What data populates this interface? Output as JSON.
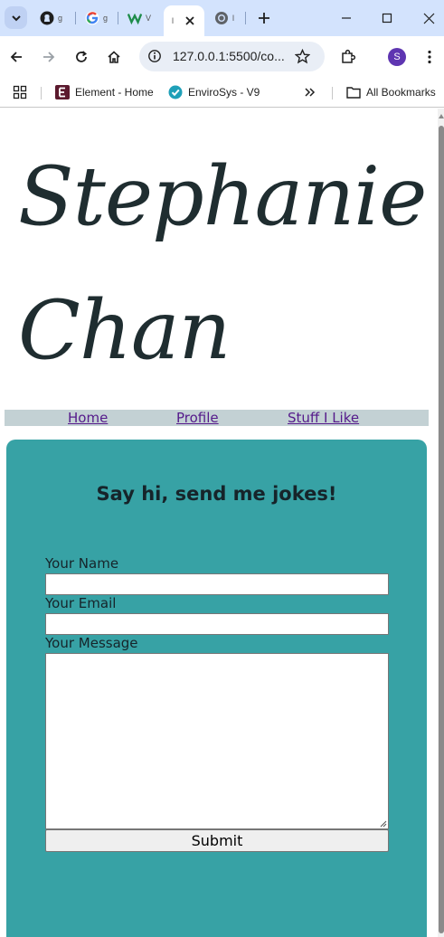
{
  "browser": {
    "tabs": [
      {
        "title": "g",
        "icon": "github-icon"
      },
      {
        "title": "g",
        "icon": "google-icon"
      },
      {
        "title": "V",
        "icon": "w-logo-icon"
      },
      {
        "title": "l",
        "icon": "blank-page-icon",
        "active": true
      },
      {
        "title": "l",
        "icon": "chrome-icon"
      }
    ],
    "url": "127.0.0.1:5500/co...",
    "profile_initial": "S",
    "bookmarks": [
      {
        "label": "Element - Home",
        "icon": "element-e-icon"
      },
      {
        "label": "EnviroSys - V9",
        "icon": "check-badge-icon"
      }
    ],
    "all_bookmarks_label": "All Bookmarks",
    "colors": {
      "tabstrip": "#d3e3fd",
      "omnibox": "#e9eef6",
      "profile": "#5e35b1"
    }
  },
  "page": {
    "name_line1": "Stephanie",
    "name_line2": "Chan",
    "nav": [
      {
        "label": "Home"
      },
      {
        "label": "Profile"
      },
      {
        "label": "Stuff I Like"
      }
    ],
    "form": {
      "title": "Say hi, send me jokes!",
      "name_label": "Your Name",
      "name_value": "",
      "email_label": "Your Email",
      "email_value": "",
      "message_label": "Your Message",
      "message_value": "",
      "submit_label": "Submit"
    },
    "colors": {
      "nav_bg": "#c3d1d4",
      "card_bg": "#37a2a5",
      "heading_text": "#16242a",
      "link": "#551a8b"
    }
  }
}
